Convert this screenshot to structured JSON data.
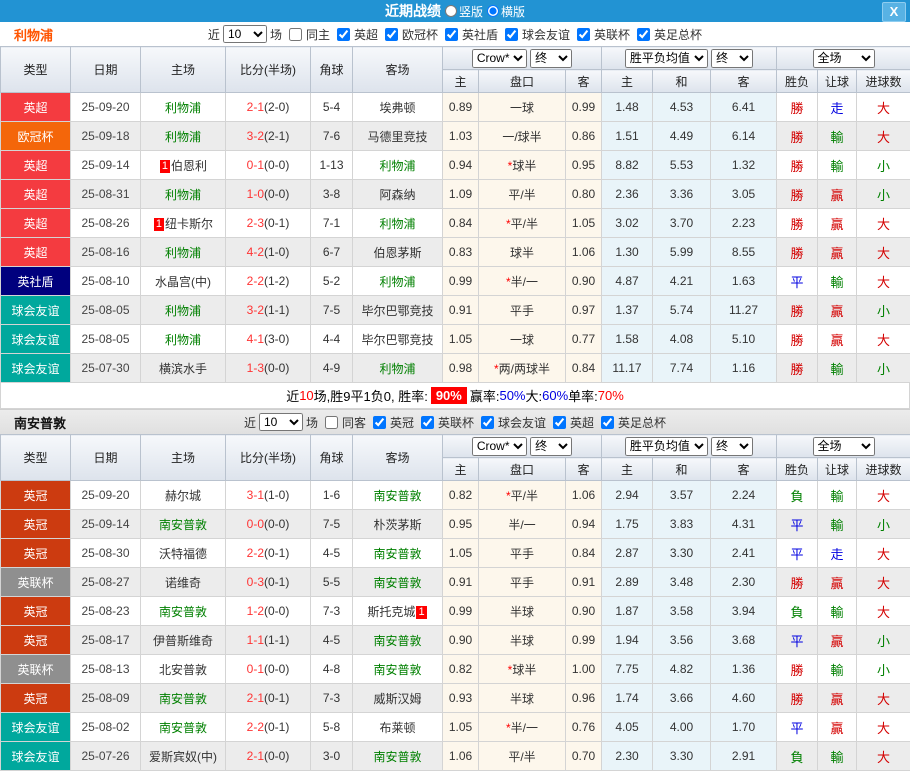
{
  "titlebar": {
    "title": "近期战绩",
    "radio_vertical": "竖版",
    "radio_horizontal": "横版",
    "selected": "横版",
    "close_label": "X"
  },
  "header_labels": {
    "type": "类型",
    "date": "日期",
    "home": "主场",
    "score": "比分(半场)",
    "corner": "角球",
    "away": "客场",
    "odds_source": "Crow*",
    "final1": "终",
    "avg_select": "胜平负均值",
    "final2": "终",
    "scope_select": "全场",
    "sub": [
      "主",
      "盘口",
      "客",
      "主",
      "和",
      "客",
      "胜负",
      "让球",
      "进球数"
    ]
  },
  "filter_common": {
    "near": "近",
    "count": "10",
    "games": "场"
  },
  "league_colors": {
    "英超": "#f43b40",
    "欧冠杯": "#f4660a",
    "英社盾": "#00007e",
    "球会友谊": "#00a89d",
    "英冠": "#cc3b10",
    "英联杯": "#8f8f8f"
  },
  "outcome_colors": {
    "勝": "c-red",
    "贏": "c-red",
    "大": "c-red",
    "平": "c-blue",
    "走": "c-blue",
    "負": "c-green",
    "輸": "c-green",
    "小": "c-green"
  },
  "sections": [
    {
      "team": "利物浦",
      "team_color_class": "orange",
      "same_label": "同主",
      "same_checked": false,
      "leagues": [
        "英超",
        "欧冠杯",
        "英社盾",
        "球会友谊",
        "英联杯",
        "英足总杯"
      ],
      "rows": [
        {
          "league": "英超",
          "date": "25-09-20",
          "home": {
            "name": "利物浦",
            "self": true
          },
          "ft": "2-1",
          "ht": "(2-0)",
          "corner": "5-4",
          "away": {
            "name": "埃弗顿",
            "self": false
          },
          "ah": "0.89",
          "line": "一球",
          "star": false,
          "aa": "0.99",
          "eh": "1.48",
          "ed": "4.53",
          "ea": "6.41",
          "res": [
            "勝",
            "走",
            "大"
          ]
        },
        {
          "league": "欧冠杯",
          "date": "25-09-18",
          "home": {
            "name": "利物浦",
            "self": true
          },
          "ft": "3-2",
          "ht": "(2-1)",
          "corner": "7-6",
          "away": {
            "name": "马德里竞技",
            "self": false
          },
          "ah": "1.03",
          "line": "一/球半",
          "star": false,
          "aa": "0.86",
          "eh": "1.51",
          "ed": "4.49",
          "ea": "6.14",
          "res": [
            "勝",
            "輸",
            "大"
          ]
        },
        {
          "league": "英超",
          "date": "25-09-14",
          "home": {
            "name": "伯恩利",
            "self": false,
            "badge": "1",
            "badgePos": "l"
          },
          "ft": "0-1",
          "ht": "(0-0)",
          "corner": "1-13",
          "away": {
            "name": "利物浦",
            "self": true
          },
          "ah": "0.94",
          "line": "球半",
          "star": true,
          "aa": "0.95",
          "eh": "8.82",
          "ed": "5.53",
          "ea": "1.32",
          "res": [
            "勝",
            "輸",
            "小"
          ]
        },
        {
          "league": "英超",
          "date": "25-08-31",
          "home": {
            "name": "利物浦",
            "self": true
          },
          "ft": "1-0",
          "ht": "(0-0)",
          "corner": "3-8",
          "away": {
            "name": "阿森纳",
            "self": false
          },
          "ah": "1.09",
          "line": "平/半",
          "star": false,
          "aa": "0.80",
          "eh": "2.36",
          "ed": "3.36",
          "ea": "3.05",
          "res": [
            "勝",
            "贏",
            "小"
          ]
        },
        {
          "league": "英超",
          "date": "25-08-26",
          "home": {
            "name": "纽卡斯尔",
            "self": false,
            "badge": "1",
            "badgePos": "l"
          },
          "ft": "2-3",
          "ht": "(0-1)",
          "corner": "7-1",
          "away": {
            "name": "利物浦",
            "self": true
          },
          "ah": "0.84",
          "line": "平/半",
          "star": true,
          "aa": "1.05",
          "eh": "3.02",
          "ed": "3.70",
          "ea": "2.23",
          "res": [
            "勝",
            "贏",
            "大"
          ]
        },
        {
          "league": "英超",
          "date": "25-08-16",
          "home": {
            "name": "利物浦",
            "self": true
          },
          "ft": "4-2",
          "ht": "(1-0)",
          "corner": "6-7",
          "away": {
            "name": "伯恩茅斯",
            "self": false
          },
          "ah": "0.83",
          "line": "球半",
          "star": false,
          "aa": "1.06",
          "eh": "1.30",
          "ed": "5.99",
          "ea": "8.55",
          "res": [
            "勝",
            "贏",
            "大"
          ]
        },
        {
          "league": "英社盾",
          "date": "25-08-10",
          "home": {
            "name": "水晶宫(中)",
            "self": false
          },
          "ft": "2-2",
          "ht": "(1-2)",
          "corner": "5-2",
          "away": {
            "name": "利物浦",
            "self": true
          },
          "ah": "0.99",
          "line": "半/一",
          "star": true,
          "aa": "0.90",
          "eh": "4.87",
          "ed": "4.21",
          "ea": "1.63",
          "res": [
            "平",
            "輸",
            "大"
          ]
        },
        {
          "league": "球会友谊",
          "date": "25-08-05",
          "home": {
            "name": "利物浦",
            "self": true
          },
          "ft": "3-2",
          "ht": "(1-1)",
          "corner": "7-5",
          "away": {
            "name": "毕尔巴鄂竞技",
            "self": false
          },
          "ah": "0.91",
          "line": "平手",
          "star": false,
          "aa": "0.97",
          "eh": "1.37",
          "ed": "5.74",
          "ea": "11.27",
          "res": [
            "勝",
            "贏",
            "小"
          ]
        },
        {
          "league": "球会友谊",
          "date": "25-08-05",
          "home": {
            "name": "利物浦",
            "self": true
          },
          "ft": "4-1",
          "ht": "(3-0)",
          "corner": "4-4",
          "away": {
            "name": "毕尔巴鄂竞技",
            "self": false
          },
          "ah": "1.05",
          "line": "一球",
          "star": false,
          "aa": "0.77",
          "eh": "1.58",
          "ed": "4.08",
          "ea": "5.10",
          "res": [
            "勝",
            "贏",
            "大"
          ]
        },
        {
          "league": "球会友谊",
          "date": "25-07-30",
          "home": {
            "name": "横滨水手",
            "self": false
          },
          "ft": "1-3",
          "ht": "(0-0)",
          "corner": "4-9",
          "away": {
            "name": "利物浦",
            "self": true
          },
          "ah": "0.98",
          "line": "两/两球半",
          "star": true,
          "aa": "0.84",
          "eh": "11.17",
          "ed": "7.74",
          "ea": "1.16",
          "res": [
            "勝",
            "輸",
            "小"
          ]
        }
      ],
      "summary_parts": [
        {
          "t": "近",
          "c": "k"
        },
        {
          "t": "10",
          "c": "r"
        },
        {
          "t": "场,胜9平1负0, 胜率:",
          "c": "k"
        },
        {
          "t": "90%",
          "c": "badge"
        },
        {
          "t": " 赢率:",
          "c": "k"
        },
        {
          "t": "50%",
          "c": "b"
        },
        {
          "t": " 大:",
          "c": "k"
        },
        {
          "t": "60%",
          "c": "b"
        },
        {
          "t": " 单率:",
          "c": "k"
        },
        {
          "t": "70%",
          "c": "r"
        }
      ]
    },
    {
      "team": "南安普敦",
      "team_color_class": "black",
      "same_label": "同客",
      "same_checked": false,
      "leagues": [
        "英冠",
        "英联杯",
        "球会友谊",
        "英超",
        "英足总杯"
      ],
      "rows": [
        {
          "league": "英冠",
          "date": "25-09-20",
          "home": {
            "name": "赫尔城",
            "self": false
          },
          "ft": "3-1",
          "ht": "(1-0)",
          "corner": "1-6",
          "away": {
            "name": "南安普敦",
            "self": true
          },
          "ah": "0.82",
          "line": "平/半",
          "star": true,
          "aa": "1.06",
          "eh": "2.94",
          "ed": "3.57",
          "ea": "2.24",
          "res": [
            "負",
            "輸",
            "大"
          ]
        },
        {
          "league": "英冠",
          "date": "25-09-14",
          "home": {
            "name": "南安普敦",
            "self": true
          },
          "ft": "0-0",
          "ht": "(0-0)",
          "corner": "7-5",
          "away": {
            "name": "朴茨茅斯",
            "self": false
          },
          "ah": "0.95",
          "line": "半/一",
          "star": false,
          "aa": "0.94",
          "eh": "1.75",
          "ed": "3.83",
          "ea": "4.31",
          "res": [
            "平",
            "輸",
            "小"
          ]
        },
        {
          "league": "英冠",
          "date": "25-08-30",
          "home": {
            "name": "沃特福德",
            "self": false
          },
          "ft": "2-2",
          "ht": "(0-1)",
          "corner": "4-5",
          "away": {
            "name": "南安普敦",
            "self": true
          },
          "ah": "1.05",
          "line": "平手",
          "star": false,
          "aa": "0.84",
          "eh": "2.87",
          "ed": "3.30",
          "ea": "2.41",
          "res": [
            "平",
            "走",
            "大"
          ]
        },
        {
          "league": "英联杯",
          "date": "25-08-27",
          "home": {
            "name": "诺维奇",
            "self": false
          },
          "ft": "0-3",
          "ht": "(0-1)",
          "corner": "5-5",
          "away": {
            "name": "南安普敦",
            "self": true
          },
          "ah": "0.91",
          "line": "平手",
          "star": false,
          "aa": "0.91",
          "eh": "2.89",
          "ed": "3.48",
          "ea": "2.30",
          "res": [
            "勝",
            "贏",
            "大"
          ]
        },
        {
          "league": "英冠",
          "date": "25-08-23",
          "home": {
            "name": "南安普敦",
            "self": true
          },
          "ft": "1-2",
          "ht": "(0-0)",
          "corner": "7-3",
          "away": {
            "name": "斯托克城",
            "self": false,
            "badge": "1",
            "badgePos": "r"
          },
          "ah": "0.99",
          "line": "半球",
          "star": false,
          "aa": "0.90",
          "eh": "1.87",
          "ed": "3.58",
          "ea": "3.94",
          "res": [
            "負",
            "輸",
            "大"
          ]
        },
        {
          "league": "英冠",
          "date": "25-08-17",
          "home": {
            "name": "伊普斯维奇",
            "self": false
          },
          "ft": "1-1",
          "ht": "(1-1)",
          "corner": "4-5",
          "away": {
            "name": "南安普敦",
            "self": true
          },
          "ah": "0.90",
          "line": "半球",
          "star": false,
          "aa": "0.99",
          "eh": "1.94",
          "ed": "3.56",
          "ea": "3.68",
          "res": [
            "平",
            "贏",
            "小"
          ]
        },
        {
          "league": "英联杯",
          "date": "25-08-13",
          "home": {
            "name": "北安普敦",
            "self": false
          },
          "ft": "0-1",
          "ht": "(0-0)",
          "corner": "4-8",
          "away": {
            "name": "南安普敦",
            "self": true
          },
          "ah": "0.82",
          "line": "球半",
          "star": true,
          "aa": "1.00",
          "eh": "7.75",
          "ed": "4.82",
          "ea": "1.36",
          "res": [
            "勝",
            "輸",
            "小"
          ]
        },
        {
          "league": "英冠",
          "date": "25-08-09",
          "home": {
            "name": "南安普敦",
            "self": true
          },
          "ft": "2-1",
          "ht": "(0-1)",
          "corner": "7-3",
          "away": {
            "name": "威斯汉姆",
            "self": false
          },
          "ah": "0.93",
          "line": "半球",
          "star": false,
          "aa": "0.96",
          "eh": "1.74",
          "ed": "3.66",
          "ea": "4.60",
          "res": [
            "勝",
            "贏",
            "大"
          ]
        },
        {
          "league": "球会友谊",
          "date": "25-08-02",
          "home": {
            "name": "南安普敦",
            "self": true
          },
          "ft": "2-2",
          "ht": "(0-1)",
          "corner": "5-8",
          "away": {
            "name": "布莱顿",
            "self": false
          },
          "ah": "1.05",
          "line": "半/一",
          "star": true,
          "aa": "0.76",
          "eh": "4.05",
          "ed": "4.00",
          "ea": "1.70",
          "res": [
            "平",
            "贏",
            "大"
          ]
        },
        {
          "league": "球会友谊",
          "date": "25-07-26",
          "home": {
            "name": "爱斯宾奴(中)",
            "self": false
          },
          "ft": "2-1",
          "ht": "(0-0)",
          "corner": "3-0",
          "away": {
            "name": "南安普敦",
            "self": true
          },
          "ah": "1.06",
          "line": "平/半",
          "star": false,
          "aa": "0.70",
          "eh": "2.30",
          "ed": "3.30",
          "ea": "2.91",
          "res": [
            "負",
            "輸",
            "大"
          ]
        }
      ],
      "summary_parts": null
    }
  ]
}
